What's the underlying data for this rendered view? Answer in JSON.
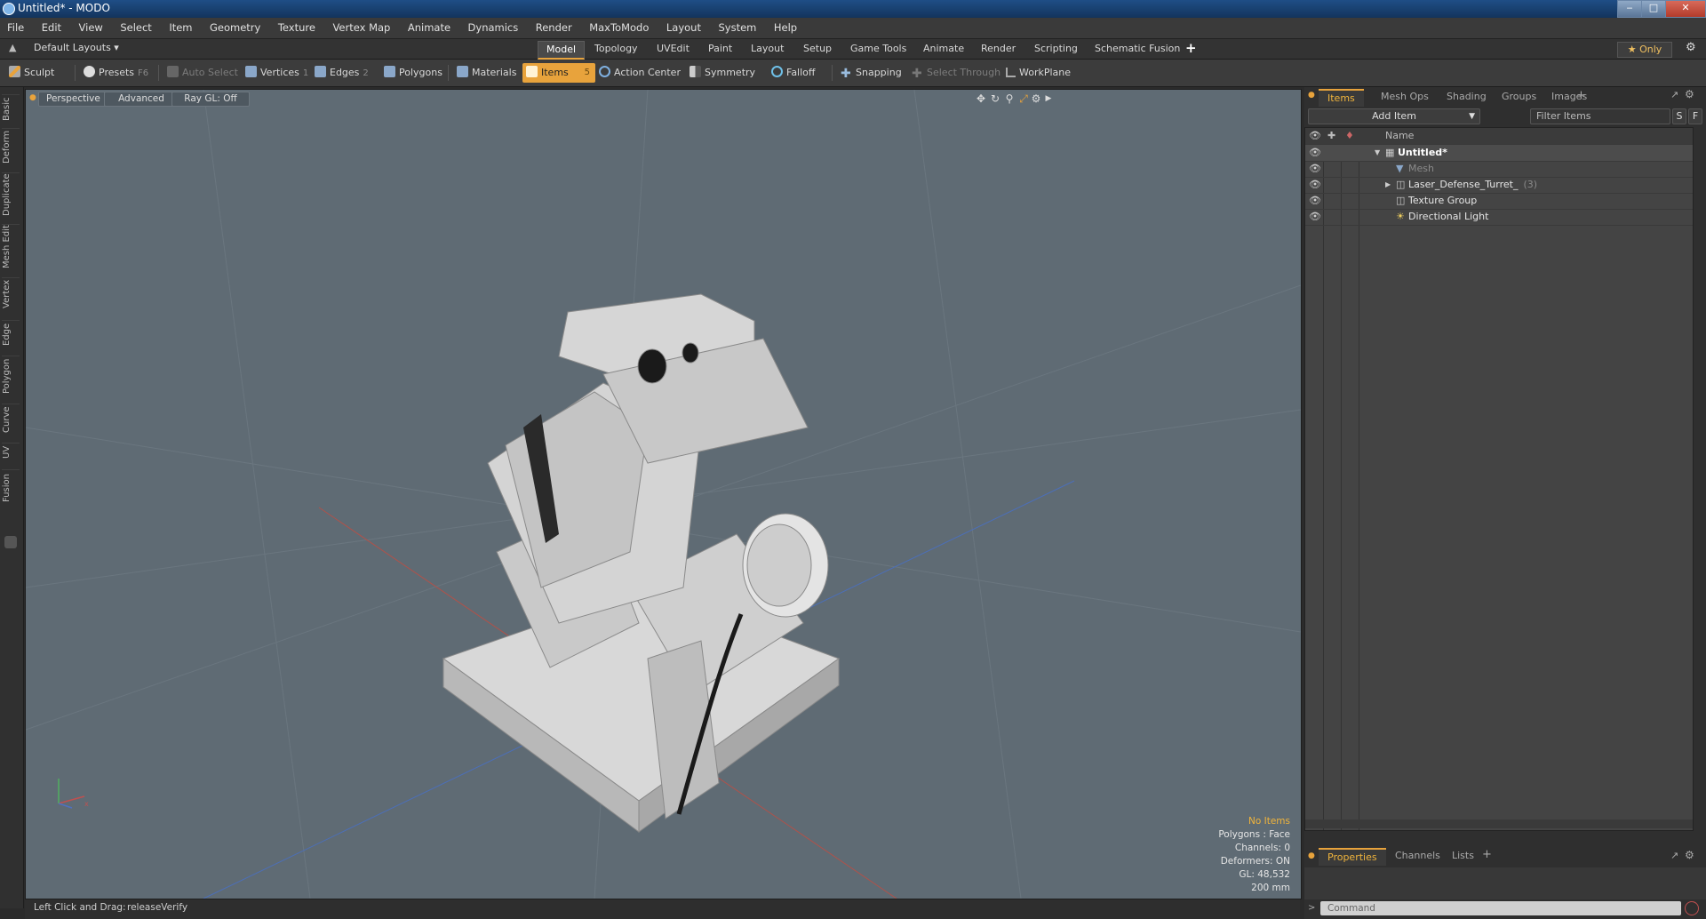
{
  "window": {
    "title": "Untitled* - MODO",
    "min_label": "‒",
    "max_label": "□",
    "close_label": "✕"
  },
  "menu": [
    "File",
    "Edit",
    "View",
    "Select",
    "Item",
    "Geometry",
    "Texture",
    "Vertex Map",
    "Animate",
    "Dynamics",
    "Render",
    "MaxToModo",
    "Layout",
    "System",
    "Help"
  ],
  "layouts": {
    "selector": "Default Layouts ▾",
    "tabs": [
      "Model",
      "Topology",
      "UVEdit",
      "Paint",
      "Layout",
      "Setup",
      "Game Tools",
      "Animate",
      "Render",
      "Scripting",
      "Schematic Fusion"
    ],
    "active": "Model",
    "add": "+",
    "only": "★ Only",
    "gear": "⚙"
  },
  "toolbar": {
    "sculpt": "Sculpt",
    "presets": "Presets",
    "presets_key": "F6",
    "auto_select": "Auto Select",
    "vertices": "Vertices",
    "vertices_key": "1",
    "edges": "Edges",
    "edges_key": "2",
    "polygons": "Polygons",
    "materials": "Materials",
    "items": "Items",
    "items_key": "5",
    "action_center": "Action Center",
    "symmetry": "Symmetry",
    "falloff": "Falloff",
    "snapping": "Snapping",
    "select_through": "Select Through",
    "workplane": "WorkPlane"
  },
  "left_tabs": [
    "Basic",
    "Deform",
    "Duplicate",
    "Mesh Edit",
    "Vertex",
    "Edge",
    "Polygon",
    "Curve",
    "UV",
    "Fusion"
  ],
  "viewport": {
    "view": "Perspective",
    "shading": "Advanced",
    "raygl": "Ray GL: Off",
    "info": {
      "selection": "No Items",
      "polygons": "Polygons : Face",
      "channels": "Channels: 0",
      "deformers": "Deformers: ON",
      "gl": "GL: 48,532",
      "scale": "200 mm"
    }
  },
  "status": {
    "hint": "Left Click and Drag:",
    "action": "releaseVerify"
  },
  "items_panel": {
    "tabs": [
      "Items",
      "Mesh Ops",
      "Shading",
      "Groups",
      "Images"
    ],
    "active": "Items",
    "add_tab": "+",
    "add_item": "Add Item",
    "filter_placeholder": "Filter Items",
    "s_btn": "S",
    "f_btn": "F",
    "col_name": "Name",
    "rows": [
      {
        "label": "Untitled*",
        "indent": 0
      },
      {
        "label": "Mesh",
        "indent": 1
      },
      {
        "label": "Laser_Defense_Turret_",
        "count": "(3)",
        "indent": 1
      },
      {
        "label": "Texture Group",
        "indent": 1
      },
      {
        "label": "Directional Light",
        "indent": 1
      }
    ]
  },
  "properties_panel": {
    "tabs": [
      "Properties",
      "Channels",
      "Lists"
    ],
    "active": "Properties",
    "add_tab": "+"
  },
  "command": {
    "placeholder": "Command"
  },
  "colors": {
    "accent": "#e8a33c",
    "viewport_bg": "#5f6b74",
    "panel_bg": "#444444"
  }
}
